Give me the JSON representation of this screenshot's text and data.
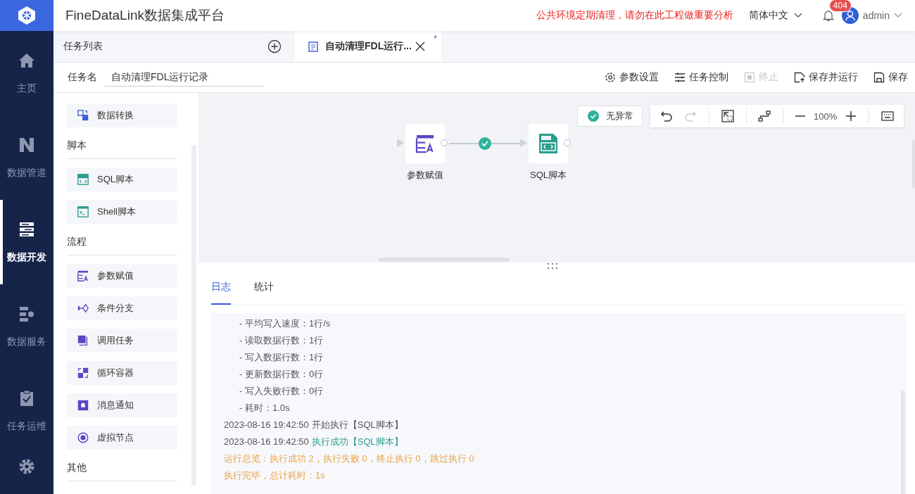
{
  "app": {
    "title": "FineDataLink数据集成平台",
    "notice": "公共环境定期清理，请勿在此工程做重要分析",
    "language": "简体中文",
    "notification_count": "404",
    "user": "admin"
  },
  "nav": [
    {
      "label": "主页",
      "selected": false
    },
    {
      "label": "数据管道",
      "selected": false
    },
    {
      "label": "数据开发",
      "selected": true
    },
    {
      "label": "数据服务",
      "selected": false
    },
    {
      "label": "任务运维",
      "selected": false
    }
  ],
  "task_tabs": {
    "list_label": "任务列表",
    "tabs": [
      {
        "label": "自动清理FDL运行...",
        "modified_mark": "*",
        "selected": true
      }
    ]
  },
  "task_name": {
    "label": "任务名",
    "value": "自动清理FDL运行记录"
  },
  "actions": [
    {
      "label": "参数设置",
      "disabled": false
    },
    {
      "label": "任务控制",
      "disabled": false
    },
    {
      "label": "终止",
      "disabled": true
    },
    {
      "label": "保存并运行",
      "disabled": false
    },
    {
      "label": "保存",
      "disabled": false
    }
  ],
  "palette": [
    {
      "items": [
        "数据转换"
      ]
    },
    {
      "heading": "脚本",
      "items": [
        "SQL脚本",
        "Shell脚本"
      ]
    },
    {
      "heading": "流程",
      "items": [
        "参数赋值",
        "条件分支",
        "调用任务",
        "循环容器",
        "消息通知",
        "虚拟节点"
      ]
    },
    {
      "heading": "其他"
    }
  ],
  "canvas": {
    "status": "无异常",
    "undo_disabled": false,
    "redo_disabled": true,
    "zoom": "100%",
    "nodes": [
      {
        "label": "参数赋值"
      },
      {
        "label": "SQL脚本"
      }
    ],
    "links": [
      {
        "succeeded": true
      }
    ]
  },
  "log": {
    "tabs": [
      {
        "label": "日志",
        "selected": true
      },
      {
        "label": "统计",
        "selected": false
      }
    ],
    "lines": [
      {
        "kind": "detail",
        "text": "- 平均写入速度：1行/s"
      },
      {
        "kind": "detail",
        "text": "- 读取数据行数：1行"
      },
      {
        "kind": "detail",
        "text": "- 写入数据行数：1行"
      },
      {
        "kind": "detail",
        "text": "- 更新数据行数：0行"
      },
      {
        "kind": "detail",
        "text": "- 写入失败行数：0行"
      },
      {
        "kind": "detail",
        "text": "- 耗时：1.0s"
      },
      {
        "kind": "info",
        "time": "2023-08-16 19:42:50",
        "text": "开始执行【SQL脚本】"
      },
      {
        "kind": "success",
        "time": "2023-08-16 19:42:50",
        "text": "执行成功【SQL脚本】"
      },
      {
        "kind": "summary",
        "text": "运行总览：执行成功 2，执行失败 0，终止执行 0，跳过执行 0"
      },
      {
        "kind": "summary",
        "text": "执行完毕，总计耗时：1s"
      }
    ]
  }
}
